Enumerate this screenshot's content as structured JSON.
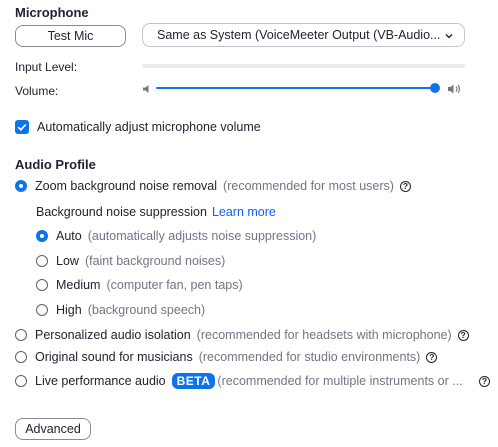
{
  "microphone": {
    "title": "Microphone",
    "test_button": "Test Mic",
    "device_select": "Same as System (VoiceMeeter Output (VB-Audio...",
    "input_level_label": "Input Level:",
    "input_level": 0.0,
    "volume_label": "Volume:",
    "volume": 0.98,
    "auto_adjust_label": "Automatically adjust microphone volume",
    "auto_adjust_checked": true
  },
  "audio_profile": {
    "title": "Audio Profile",
    "zoom_noise": {
      "label": "Zoom background noise removal",
      "hint": "(recommended for most users)",
      "selected": true
    },
    "suppression_label": "Background noise suppression",
    "learn_more": "Learn more",
    "suppression_options": [
      {
        "label": "Auto",
        "hint": "(automatically adjusts noise suppression)",
        "selected": true
      },
      {
        "label": "Low",
        "hint": "(faint background noises)",
        "selected": false
      },
      {
        "label": "Medium",
        "hint": "(computer fan, pen taps)",
        "selected": false
      },
      {
        "label": "High",
        "hint": "(background speech)",
        "selected": false
      }
    ],
    "personalized": {
      "label": "Personalized audio isolation",
      "hint": "(recommended for headsets with microphone)"
    },
    "original_sound": {
      "label": "Original sound for musicians",
      "hint": "(recommended for studio environments)"
    },
    "live_performance": {
      "label": "Live performance audio",
      "badge": "BETA",
      "hint": "(recommended for multiple instruments or ..."
    }
  },
  "advanced_button": "Advanced",
  "colors": {
    "accent": "#0e72ed",
    "text": "#232333",
    "hint": "#747487",
    "link": "#0b5cff"
  },
  "icons": [
    "chevron-down-icon",
    "speaker-low-icon",
    "speaker-high-icon",
    "checkbox-icon",
    "help-icon"
  ]
}
